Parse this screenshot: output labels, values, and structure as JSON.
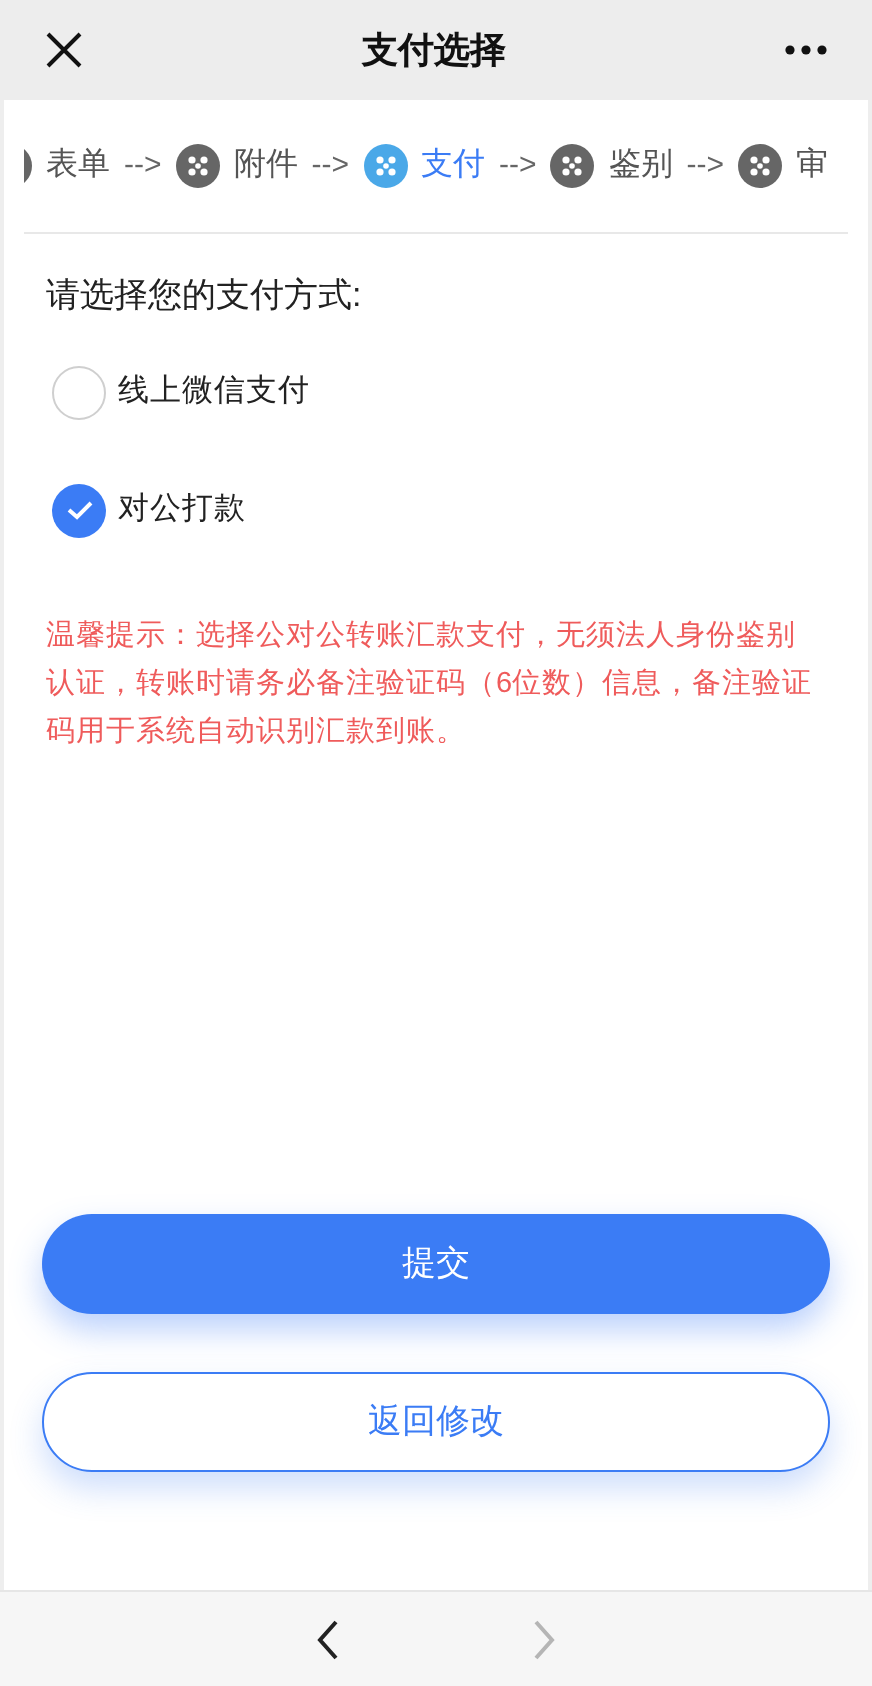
{
  "top_bar": {
    "title": "支付选择"
  },
  "steps": [
    {
      "label": "表单",
      "selected": false,
      "arrow": "-->"
    },
    {
      "label": "附件",
      "selected": false,
      "arrow": "-->"
    },
    {
      "label": "支付",
      "selected": true,
      "arrow": "-->"
    },
    {
      "label": "鉴别",
      "selected": false,
      "arrow": "-->"
    },
    {
      "label": "审",
      "selected": false
    }
  ],
  "prompt": "请选择您的支付方式:",
  "options": [
    {
      "label": "线上微信支付",
      "selected": false
    },
    {
      "label": "对公打款",
      "selected": true
    }
  ],
  "notice": "温馨提示：选择公对公转账汇款支付，无须法人身份鉴别认证，转账时请务必备注验证码（6位数）信息，备注验证码用于系统自动识别汇款到账。",
  "buttons": [
    {
      "label": "提交",
      "kind": "primary"
    },
    {
      "label": "返回修改",
      "kind": "outline"
    }
  ],
  "bottom_nav": {
    "back_disabled": false,
    "forward_disabled": true
  }
}
